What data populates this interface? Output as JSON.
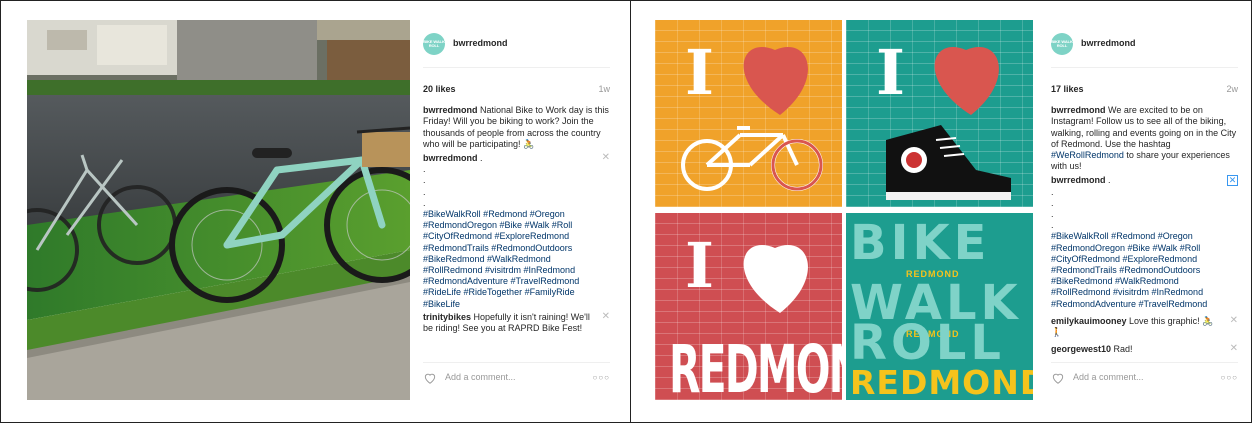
{
  "posts": [
    {
      "username": "bwrredmond",
      "avatar_text": "BIKE WALK ROLL",
      "likes": "20 likes",
      "age": "1w",
      "caption_user": "bwrredmond",
      "caption_text": "National Bike to Work day is this Friday! Will you be biking to work? Join the thousands of people from across the country who will be participating! 🚴",
      "comments": [
        {
          "user": "bwrredmond",
          "text": ".",
          "dots": ".\n.\n.\n.",
          "tags": "#BikeWalkRoll #Redmond #Oregon\n#RedmondOregon #Bike #Walk #Roll\n#CityOfRedmond #ExploreRedmond\n#RedmondTrails #RedmondOutdoors\n#BikeRedmond #WalkRedmond\n#RollRedmond #visitrdm #InRedmond\n#RedmondAdventure #TravelRedmond\n#RideLife #RideTogether #FamilyRide\n#BikeLife"
        },
        {
          "user": "trinitybikes",
          "text": "Hopefully it isn't raining! We'll be riding! See you at RAPRD Bike Fest!"
        }
      ],
      "add_comment_placeholder": "Add a comment...",
      "more": "○○○"
    },
    {
      "username": "bwrredmond",
      "avatar_text": "BIKE WALK ROLL",
      "likes": "17 likes",
      "age": "2w",
      "caption_user": "bwrredmond",
      "caption_text": "We are excited to be on Instagram! Follow us to see all of the biking, walking, rolling and events going on in the City of Redmond. Use the hashtag ",
      "caption_tag": "#WeRollRedmond",
      "caption_tail": " to share your experiences with us!",
      "comments": [
        {
          "user": "bwrredmond",
          "text": ".",
          "dots": ".\n.\n.\n.",
          "tags": "#BikeWalkRoll #Redmond #Oregon\n#RedmondOregon #Bike #Walk #Roll\n#CityOfRedmond #ExploreRedmond\n#RedmondTrails #RedmondOutdoors\n#BikeRedmond #WalkRedmond\n#RollRedmond #visitrdm #InRedmond\n#RedmondAdventure #TravelRedmond"
        },
        {
          "user": "emilykauimooney",
          "text": "Love this graphic! 🚴 🚶"
        },
        {
          "user": "georgewest10",
          "text": "Rad!"
        }
      ],
      "add_comment_placeholder": "Add a comment...",
      "more": "○○○"
    }
  ],
  "collage": {
    "tile1_text": "I",
    "tile2_text": "I",
    "tile3_text": "I",
    "tile3_word": "REDMOND",
    "tile4_lines": [
      "BIKE",
      "WALK",
      "ROLL"
    ],
    "tile4_small": "REDMOND",
    "tile4_bottom": "REDMOND"
  },
  "colors": {
    "tag_blue": "#003569",
    "accent_teal": "#1d9d8f",
    "accent_orange": "#f0a22a",
    "accent_red": "#cf4e52",
    "heart_red": "#d9564f",
    "yellow": "#f5c31c"
  }
}
